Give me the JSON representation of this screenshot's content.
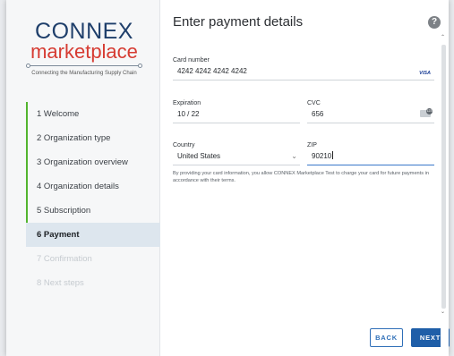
{
  "logo": {
    "line1": "CONNEX",
    "line2": "marketplace",
    "tagline": "Connecting the Manufacturing Supply Chain"
  },
  "steps": [
    {
      "label": "1  Welcome",
      "state": "done"
    },
    {
      "label": "2  Organization type",
      "state": "done"
    },
    {
      "label": "3  Organization overview",
      "state": "done"
    },
    {
      "label": "4  Organization details",
      "state": "done"
    },
    {
      "label": "5  Subscription",
      "state": "done"
    },
    {
      "label": "6  Payment",
      "state": "active"
    },
    {
      "label": "7  Confirmation",
      "state": "future"
    },
    {
      "label": "8  Next steps",
      "state": "future"
    }
  ],
  "header": {
    "title": "Enter payment details",
    "help_icon": "?"
  },
  "form": {
    "card_number": {
      "label": "Card number",
      "value": "4242 4242 4242 4242",
      "brand": "VISA"
    },
    "expiration": {
      "label": "Expiration",
      "value": "10 / 22"
    },
    "cvc": {
      "label": "CVC",
      "value": "656",
      "icon_text": "123"
    },
    "country": {
      "label": "Country",
      "value": "United States"
    },
    "zip": {
      "label": "ZIP",
      "value": "90210"
    },
    "disclaimer": "By providing your card information, you allow CONNEX Marketplace Test to charge your card for future payments in accordance with their terms."
  },
  "buttons": {
    "back": "BACK",
    "next": "NEXT"
  },
  "colors": {
    "accent": "#1f5ea8",
    "done": "#53b52f",
    "brand_red": "#d63b32",
    "brand_navy": "#1f3f6b"
  }
}
